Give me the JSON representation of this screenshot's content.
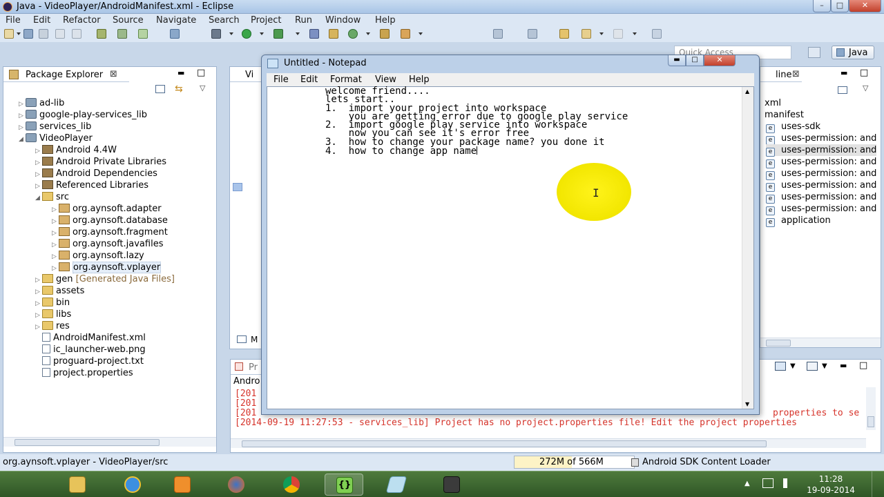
{
  "window": {
    "title": "Java - VideoPlayer/AndroidManifest.xml - Eclipse",
    "min": "–",
    "max": "□",
    "close": "✕"
  },
  "menu": [
    "File",
    "Edit",
    "Refactor",
    "Source",
    "Navigate",
    "Search",
    "Project",
    "Run",
    "Window",
    "Help"
  ],
  "quick_access": {
    "placeholder": "Quick Access"
  },
  "perspective": {
    "label": "Java"
  },
  "package_explorer": {
    "title": "Package Explorer",
    "items": [
      {
        "label": "ad-lib"
      },
      {
        "label": "google-play-services_lib"
      },
      {
        "label": "services_lib"
      },
      {
        "label": "VideoPlayer"
      },
      {
        "label": "Android 4.4W"
      },
      {
        "label": "Android Private Libraries"
      },
      {
        "label": "Android Dependencies"
      },
      {
        "label": "Referenced Libraries"
      },
      {
        "label": "src"
      },
      {
        "label": "org.aynsoft.adapter"
      },
      {
        "label": "org.aynsoft.database"
      },
      {
        "label": "org.aynsoft.fragment"
      },
      {
        "label": "org.aynsoft.javafiles"
      },
      {
        "label": "org.aynsoft.lazy"
      },
      {
        "label": "org.aynsoft.vplayer"
      },
      {
        "label": "gen",
        "suffix": "[Generated Java Files]"
      },
      {
        "label": "assets"
      },
      {
        "label": "bin"
      },
      {
        "label": "libs"
      },
      {
        "label": "res"
      },
      {
        "label": "AndroidManifest.xml"
      },
      {
        "label": "ic_launcher-web.png"
      },
      {
        "label": "proguard-project.txt"
      },
      {
        "label": "project.properties"
      }
    ]
  },
  "editor": {
    "tab_label": "Vi",
    "bottom_tab": "M"
  },
  "outline": {
    "title": "line",
    "items": [
      {
        "label": "xml"
      },
      {
        "label": "manifest"
      },
      {
        "label": "uses-sdk"
      },
      {
        "label": "uses-permission: and"
      },
      {
        "label": "uses-permission: and"
      },
      {
        "label": "uses-permission: and"
      },
      {
        "label": "uses-permission: and"
      },
      {
        "label": "uses-permission: and"
      },
      {
        "label": "uses-permission: and"
      },
      {
        "label": "uses-permission: and"
      },
      {
        "label": "application"
      }
    ]
  },
  "console": {
    "tab_label": "Pr",
    "header": "Andro",
    "lines": [
      "[201",
      "[201",
      "[201",
      "[2014-09-19 11:27:53 - services_lib] Project has no project.properties file! Edit the project properties"
    ],
    "right_fragment": "properties to se"
  },
  "notepad": {
    "title": "Untitled - Notepad",
    "menu": [
      "File",
      "Edit",
      "Format",
      "View",
      "Help"
    ],
    "lines": [
      "welcome friend....",
      "lets start..",
      "",
      "1.  import your project into workspace",
      "    you are getting error due to google play service",
      "2.  import google play service into workspace",
      "    now you can see it's error free",
      "",
      "3.  how to change your package name? you done it",
      "4.  how to change app name"
    ]
  },
  "status": {
    "selection": "org.aynsoft.vplayer - VideoPlayer/src",
    "heap": "272M of 566M",
    "heap_used_fraction": 0.48,
    "job": "Android SDK Content Loader"
  },
  "taskbar": {
    "apps": [
      "explorer",
      "internet-explorer",
      "media-player",
      "firefox",
      "chrome",
      "code-editor",
      "eraser-tool",
      "camera"
    ],
    "time": "11:28",
    "date": "19-09-2014"
  },
  "colors": {
    "eclipse_bg": "#c8d7e9",
    "error_text": "#d6332a",
    "taskbar": "#3d6a30",
    "highlight": "#f5e900"
  }
}
